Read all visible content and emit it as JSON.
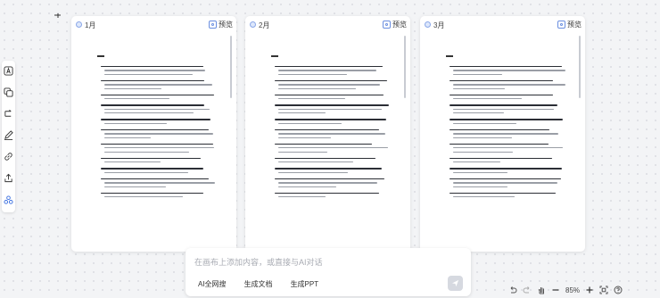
{
  "cards": [
    {
      "title": "1月",
      "preview": "预览"
    },
    {
      "title": "2月",
      "preview": "预览"
    },
    {
      "title": "3月",
      "preview": "预览"
    }
  ],
  "chat": {
    "placeholder": "在画布上添加内容，或直接与AI对话",
    "tools": [
      "AI全网搜",
      "生成文档",
      "生成PPT"
    ]
  },
  "controls": {
    "zoom": "85%"
  },
  "toolbar_icons": [
    "text-icon",
    "copy-icon",
    "flow-icon",
    "pen-icon",
    "link-icon",
    "share-icon",
    "nodes-icon"
  ]
}
